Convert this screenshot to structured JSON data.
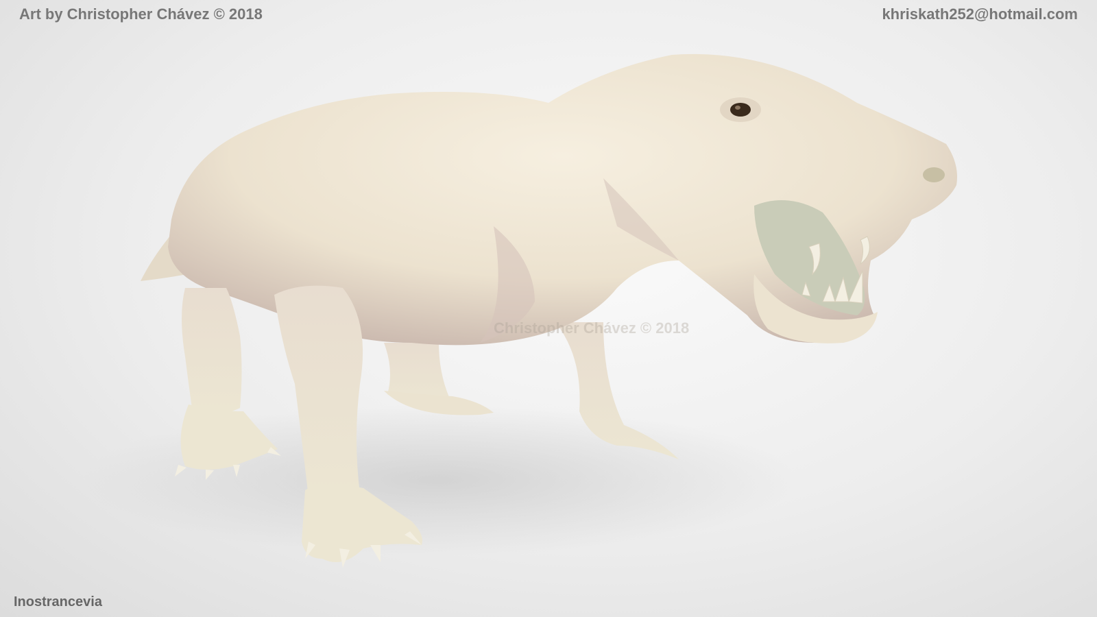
{
  "credit": "Art by Christopher Chávez © 2018",
  "email": "khriskath252@hotmail.com",
  "caption": "Inostrancevia",
  "watermark": "Christopher Chávez © 2018",
  "colors": {
    "background": "#ededed",
    "skin": "#efe6d6",
    "skin_shadow": "#cbb8b0",
    "teeth": "#f3efe2"
  }
}
